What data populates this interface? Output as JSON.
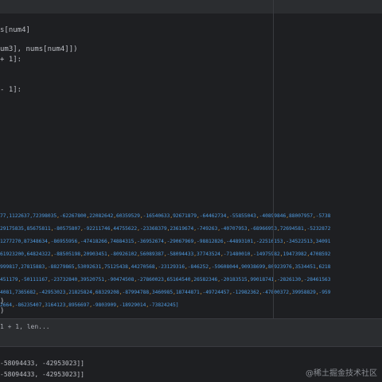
{
  "editor": {
    "code_lines": [
      "s[num4]",
      "",
      "um3], nums[num4]])",
      "+ 1]:",
      "",
      "",
      "- 1]:"
    ],
    "data_lines": [
      {
        "pre": "77,1122637,72398035",
        "rest": [
          ",-62267800",
          ",22082642",
          ",60359529",
          ",-16540633",
          ",92671879",
          ",-64462734",
          ",-55855043",
          ",-40899846",
          ",88007957",
          ",-5738"
        ]
      },
      {
        "pre": "29175835,85675811",
        "rest": [
          ",-80575807",
          ",-92211746",
          ",44755622",
          ",-23368379",
          ",23619674",
          ",-749263",
          ",-40707953",
          ",-68966953",
          ",72694581",
          ",-5232872"
        ]
      },
      {
        "pre": "1277270,87348634",
        "rest": [
          ",-86955956",
          ",-47418266",
          ",74884315",
          ",-36952674",
          ",-29067969",
          ",-98812826",
          ",-44893101",
          ",-22516153",
          ",-34522513",
          ",34091"
        ]
      },
      {
        "pre": "61923200,64824322",
        "rest": [
          ",-88505198",
          ",20903451",
          ",-80926102",
          ",56089387",
          ",-58094433",
          ",37743524",
          ",-71480010",
          ",-14975982",
          ",19473982",
          ",4708592"
        ]
      },
      {
        "pre": "999817,27815883",
        "rest": [
          ",-88279865",
          ",53092631",
          ",75125438",
          ",44270568",
          ",-23129316",
          ",-846252",
          ",-59608044",
          ",90938699",
          ",80923976",
          ",3534451",
          ",6218"
        ]
      },
      {
        "pre": "451179",
        "rest": [
          ",-50111167",
          ",-23732840",
          ",39520751",
          ",-90474508",
          ",-27860023",
          ",65164540",
          ",26582346",
          ",-20183515",
          ",99018741",
          ",-2826130",
          ",-28461563"
        ]
      },
      {
        "pre": "4081,7365682",
        "rest": [
          ",-42953023",
          ",21825824",
          ",68329208",
          ",-87994788",
          ",3460985",
          ",18744871",
          ",-49724457",
          ",-12982362",
          ",-47800372",
          ",39958829",
          ",-959"
        ]
      },
      {
        "pre": "2664",
        "rest": [
          ",-86235407",
          ",3164123",
          ",8956697",
          ",-9803909",
          ",-18929014",
          ",-73824245]"
        ]
      }
    ],
    "after_lines": [
      ")",
      ")"
    ]
  },
  "status": {
    "text": "1 + 1, len..."
  },
  "console": {
    "lines": [
      "-58094433, -42953023]]",
      "-58094433, -42953023]]"
    ]
  },
  "watermark": "@稀土掘金技术社区",
  "colors": {
    "background": "#1e1f22",
    "panel": "#2b2d30",
    "number": "#4f9ae0",
    "separator": "#e0a040",
    "text": "#bcbec4"
  }
}
